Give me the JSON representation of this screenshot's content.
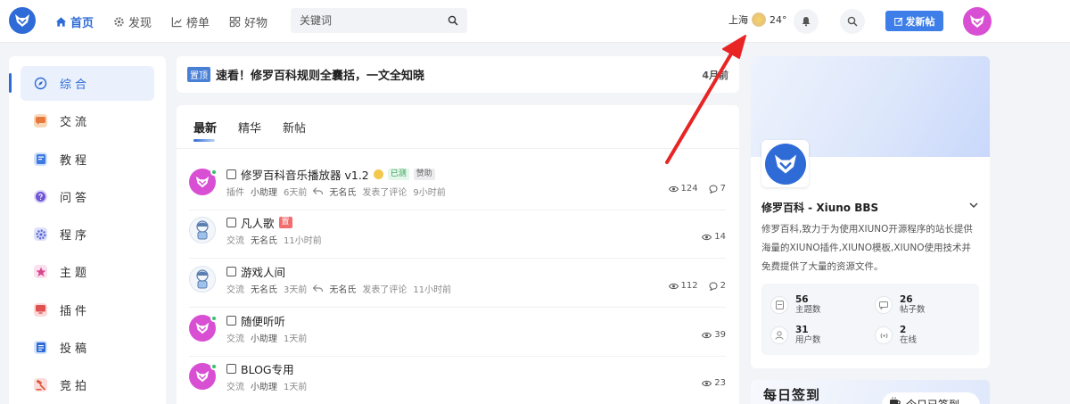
{
  "nav": {
    "items": [
      {
        "label": "首页",
        "icon": "home-icon",
        "active": true
      },
      {
        "label": "发现",
        "icon": "gear-icon",
        "active": false
      },
      {
        "label": "榜单",
        "icon": "chart-icon",
        "active": false
      },
      {
        "label": "好物",
        "icon": "grid-icon",
        "active": false
      }
    ]
  },
  "search": {
    "placeholder": "关键词"
  },
  "weather": {
    "city": "上海",
    "temp": "24°"
  },
  "header": {
    "post_label": "发新帖"
  },
  "sidebar": {
    "items": [
      {
        "label": "综合",
        "active": true
      },
      {
        "label": "交流",
        "active": false
      },
      {
        "label": "教程",
        "active": false
      },
      {
        "label": "问答",
        "active": false
      },
      {
        "label": "程序",
        "active": false
      },
      {
        "label": "主题",
        "active": false
      },
      {
        "label": "插件",
        "active": false
      },
      {
        "label": "投稿",
        "active": false
      },
      {
        "label": "竞拍",
        "active": false
      }
    ]
  },
  "notice": {
    "tag": "置顶",
    "title": "速看！修罗百科规则全囊括，一文全知晓",
    "date": "4月前"
  },
  "tabs": [
    "最新",
    "精华",
    "新帖"
  ],
  "threads": [
    {
      "title": "修罗百科音乐播放器 v1.2",
      "badges": [
        "已测",
        "赞助"
      ],
      "forum": "插件",
      "author": "小助理",
      "time": "6天前",
      "replier": "无名氏",
      "reply_text": "发表了评论",
      "reply_time": "9小时前",
      "views": "124",
      "comments": "7"
    },
    {
      "title": "凡人歌",
      "badges": [
        "置"
      ],
      "forum": "交流",
      "author": "无名氏",
      "time": "11小时前",
      "views": "14"
    },
    {
      "title": "游戏人间",
      "forum": "交流",
      "author": "无名氏",
      "time": "3天前",
      "replier": "无名氏",
      "reply_text": "发表了评论",
      "reply_time": "11小时前",
      "views": "112",
      "comments": "2"
    },
    {
      "title": "随便听听",
      "forum": "交流",
      "author": "小助理",
      "time": "1天前",
      "views": "39"
    },
    {
      "title": "BLOG专用",
      "forum": "交流",
      "author": "小助理",
      "time": "1天前",
      "views": "23"
    }
  ],
  "site": {
    "name": "修罗百科 - Xiuno BBS",
    "desc": "修罗百科,致力于为使用XIUNO开源程序的站长提供海量的XIUNO插件,XIUNO模板,XIUNO使用技术并免费提供了大量的资源文件。",
    "stats": [
      {
        "num": "56",
        "label": "主题数"
      },
      {
        "num": "26",
        "label": "帖子数"
      },
      {
        "num": "31",
        "label": "用户数"
      },
      {
        "num": "2",
        "label": "在线"
      }
    ]
  },
  "signin": {
    "title": "每日签到",
    "button": "今日已签到"
  }
}
